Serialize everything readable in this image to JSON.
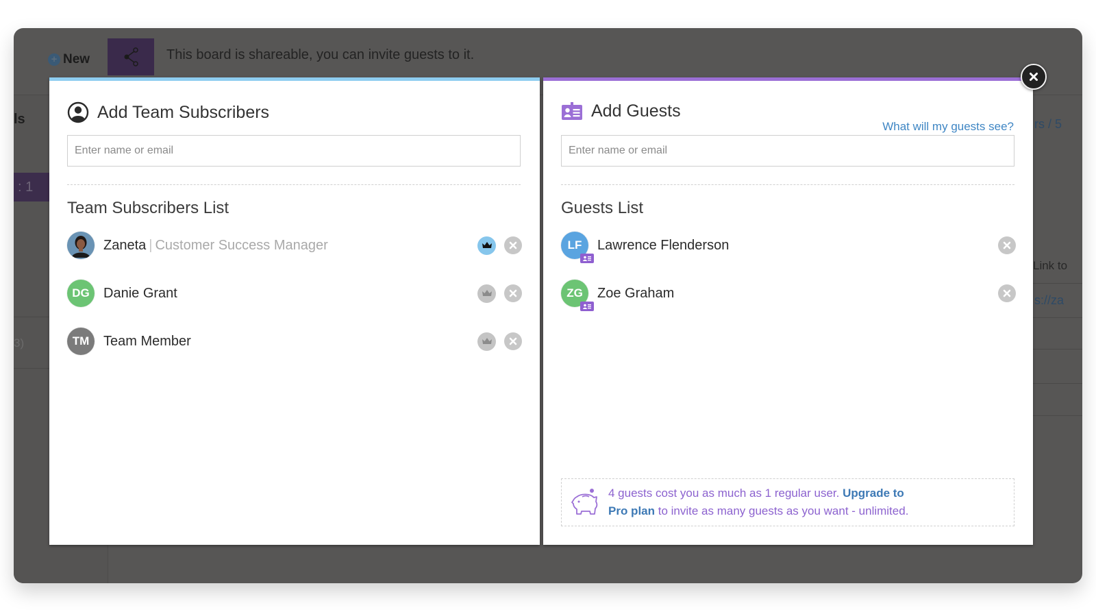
{
  "background": {
    "new_button": "New",
    "share_banner": "This board is shareable, you can invite guests to it.",
    "left_partial_label": "ls",
    "left_partial_row": ": 1",
    "left_partial_count": "3)",
    "right_partial_header": "rs / 5",
    "right_partial_link_label": "Link to",
    "right_partial_url": "s://za"
  },
  "subscribers_panel": {
    "title": "Add Team Subscribers",
    "icon": "user-circle-icon",
    "search_placeholder": "Enter name or email",
    "search_value": "",
    "list_title": "Team Subscribers List",
    "accent_color": "#8ecdf0",
    "members": [
      {
        "name": "Zaneta",
        "title": "Customer Success Manager",
        "initials": "",
        "avatar": "photo",
        "avatar_color": "#5d8db0",
        "is_owner": true
      },
      {
        "name": "Danie Grant",
        "title": "",
        "initials": "DG",
        "avatar": "initials",
        "avatar_color": "#6cc474",
        "is_owner": false
      },
      {
        "name": "Team Member",
        "title": "",
        "initials": "TM",
        "avatar": "initials",
        "avatar_color": "#7b7b7b",
        "is_owner": false
      }
    ]
  },
  "guests_panel": {
    "title": "Add Guests",
    "icon": "id-badge-icon",
    "help_link": "What will my guests see?",
    "search_placeholder": "Enter name or email",
    "search_value": "",
    "list_title": "Guests List",
    "accent_color": "#9b6fd6",
    "guests": [
      {
        "name": "Lawrence Flenderson",
        "initials": "LF",
        "avatar_color": "#5aa4e0"
      },
      {
        "name": "Zoe Graham",
        "initials": "ZG",
        "avatar_color": "#6cc474"
      }
    ],
    "promo": {
      "text_1": "4 guests cost you as much as 1 regular user. ",
      "link_1": "Upgrade to",
      "link_2": "Pro plan",
      "text_2": " to invite as many guests as you want - unlimited.",
      "icon": "piggy-bank-icon"
    }
  },
  "close_button": {
    "icon": "close-icon",
    "label": "Close"
  }
}
